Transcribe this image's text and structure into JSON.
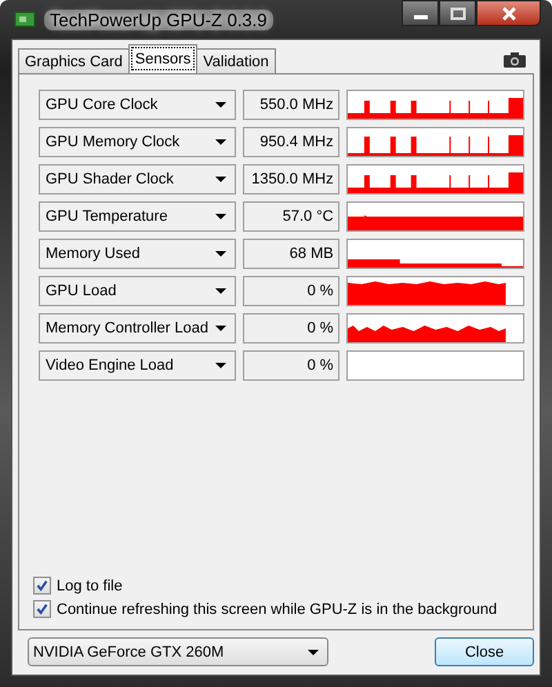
{
  "window": {
    "title": "TechPowerUp GPU-Z 0.3.9"
  },
  "tabs": [
    {
      "label": "Graphics Card",
      "selected": false
    },
    {
      "label": "Sensors",
      "selected": true
    },
    {
      "label": "Validation",
      "selected": false
    }
  ],
  "sensors": [
    {
      "name": "GPU Core Clock",
      "reading": "550.0 MHz",
      "kind": "clock"
    },
    {
      "name": "GPU Memory Clock",
      "reading": "950.4 MHz",
      "kind": "thin-clock"
    },
    {
      "name": "GPU Shader Clock",
      "reading": "1350.0 MHz",
      "kind": "clock"
    },
    {
      "name": "GPU Temperature",
      "reading": "57.0 °C",
      "kind": "temperature"
    },
    {
      "name": "Memory Used",
      "reading": "68 MB",
      "kind": "memory"
    },
    {
      "name": "GPU Load",
      "reading": "0 %",
      "kind": "load"
    },
    {
      "name": "Memory Controller Load",
      "reading": "0 %",
      "kind": "controller"
    },
    {
      "name": "Video Engine Load",
      "reading": "0 %",
      "kind": "empty"
    }
  ],
  "options": [
    {
      "label": "Log to file",
      "checked": true
    },
    {
      "label": "Continue refreshing this screen while GPU-Z is in the background",
      "checked": true
    }
  ],
  "gpu_select": {
    "value": "NVIDIA GeForce GTX 260M"
  },
  "buttons": [
    "Close"
  ]
}
